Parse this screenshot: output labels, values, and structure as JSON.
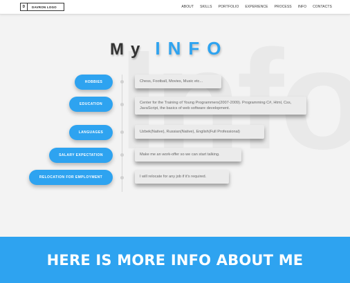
{
  "header": {
    "logo_mark": "D",
    "logo_text": "DAVRON LOGO",
    "nav": [
      "ABOUT",
      "SKILLS",
      "PORTFOLIO",
      "EXPERIENCE",
      "PROCESS",
      "INFO",
      "CONTACTS"
    ]
  },
  "watermark": "Info",
  "heading": {
    "my": "My",
    "info": "INFO"
  },
  "rows": [
    {
      "label": "HOBBIES",
      "text": "Chess, Football, Movies, Music etc..."
    },
    {
      "label": "EDUCATION",
      "text": "Center for the Training of Young Programmers(2007-2009). Programming C#, Html, Css, JavaScript, the basics of web software development."
    },
    {
      "label": "LANGUAGES",
      "text": "Uzbek(Native), Russian(Native), English(Full Professional)"
    },
    {
      "label": "SALARY EXPECTATION",
      "text": "Make me an work-offer so we can start talking."
    },
    {
      "label": "RELOCATION FOR EMPLOYMENT",
      "text": "I will relocate for any job if it's required."
    }
  ],
  "banner": "HERE IS MORE INFO ABOUT ME",
  "colors": {
    "accent": "#2ea3f0",
    "background": "#f3f3f3",
    "heading_dark": "#333333"
  }
}
